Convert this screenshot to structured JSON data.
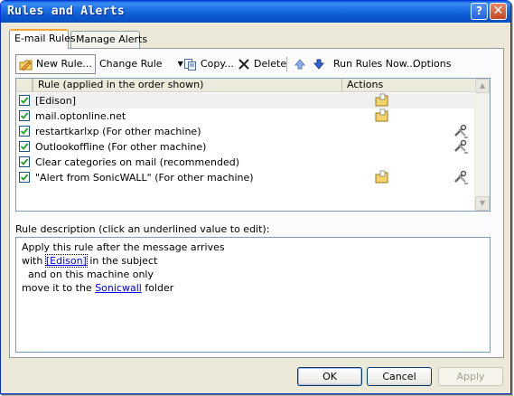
{
  "window": {
    "title": "Rules and Alerts",
    "help_label": "?",
    "close_label": "✕"
  },
  "tabs": [
    {
      "label": "E-mail Rules",
      "active": true
    },
    {
      "label": "Manage Alerts",
      "active": false
    }
  ],
  "toolbar": {
    "new_rule": "New Rule...",
    "change_rule": "Change Rule",
    "copy": "Copy...",
    "delete": "Delete",
    "run_rules": "Run Rules Now...",
    "options": "Options"
  },
  "list": {
    "headers": {
      "rule": "Rule (applied in the order shown)",
      "actions": "Actions"
    },
    "rows": [
      {
        "name": "[Edison]",
        "checked": true,
        "move_icon": true,
        "tools_icon": false
      },
      {
        "name": "mail.optonline.net",
        "checked": true,
        "move_icon": true,
        "tools_icon": false
      },
      {
        "name": "restartkarlxp  (For other machine)",
        "checked": true,
        "move_icon": false,
        "tools_icon": true
      },
      {
        "name": "Outlookoffline  (For other machine)",
        "checked": true,
        "move_icon": false,
        "tools_icon": true
      },
      {
        "name": "Clear categories on mail (recommended)",
        "checked": true,
        "move_icon": false,
        "tools_icon": false
      },
      {
        "name": "\"Alert from SonicWALL\"  (For other machine)",
        "checked": true,
        "move_icon": true,
        "tools_icon": true
      }
    ]
  },
  "description": {
    "label": "Rule description (click an underlined value to edit):",
    "line1": "Apply this rule after the message arrives",
    "line2_pre": "with ",
    "line2_link": "[Edison]",
    "line2_post": " in the subject",
    "line3": "  and on this machine only",
    "line4_pre": "move it to the ",
    "line4_link": "Sonicwall",
    "line4_post": " folder"
  },
  "buttons": {
    "ok": "OK",
    "cancel": "Cancel",
    "apply": "Apply"
  },
  "colors": {
    "titlebar": "#0a5fd8",
    "link": "#0000ee",
    "dialog_bg": "#ece9d8"
  }
}
